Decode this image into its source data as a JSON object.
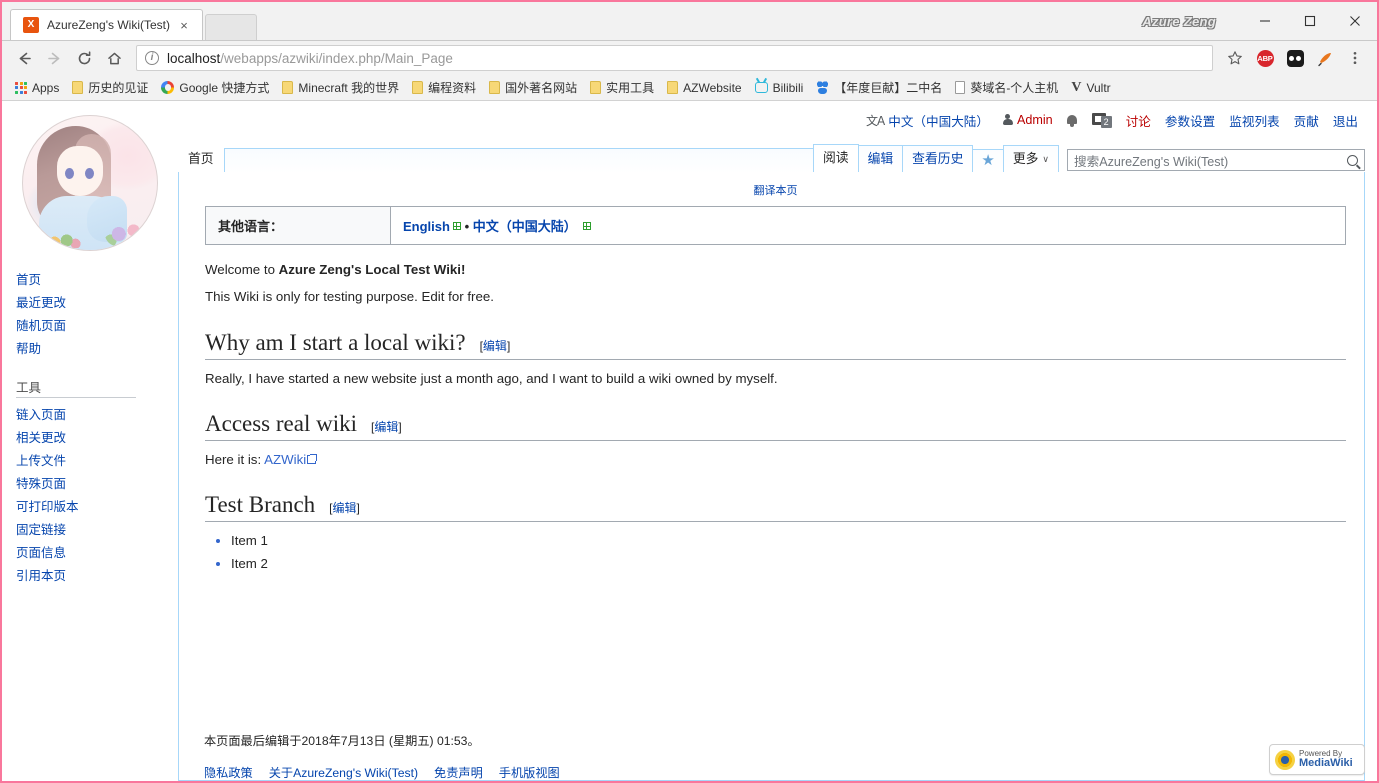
{
  "browser": {
    "tab": {
      "title": "AzureZeng's Wiki(Test)",
      "favicon_letter": "X",
      "close": "×"
    },
    "window_user": "Azure Zeng",
    "controls": {
      "minimize": "minimize-icon",
      "maximize": "maximize-icon",
      "close": "close-icon"
    },
    "nav": {
      "back": "back-icon",
      "forward": "forward-icon",
      "reload": "reload-icon",
      "home": "home-icon"
    },
    "omnibox": {
      "info": "i",
      "host": "localhost",
      "path": "/webapps/azwiki/index.php/Main_Page"
    },
    "actions": {
      "bookmark_star": "☆",
      "abp": "ABP",
      "menu": "⋮"
    },
    "bookmarks": [
      {
        "label": "Apps",
        "icon": "apps-grid-icon"
      },
      {
        "label": "历史的见证",
        "icon": "folder-icon"
      },
      {
        "label": "Google 快捷方式",
        "icon": "google-icon"
      },
      {
        "label": "Minecraft 我的世界",
        "icon": "folder-icon"
      },
      {
        "label": "编程资料",
        "icon": "folder-icon"
      },
      {
        "label": "国外著名网站",
        "icon": "folder-icon"
      },
      {
        "label": "实用工具",
        "icon": "folder-icon"
      },
      {
        "label": "AZWebsite",
        "icon": "folder-icon"
      },
      {
        "label": "Bilibili",
        "icon": "bilibili-icon"
      },
      {
        "label": "【年度巨献】二中名",
        "icon": "baidu-icon"
      },
      {
        "label": "葵域名-个人主机",
        "icon": "page-icon"
      },
      {
        "label": "Vultr",
        "icon": "vultr-icon"
      }
    ]
  },
  "wiki": {
    "personal": {
      "language": "中文（中国大陆）",
      "language_icon": "文A",
      "user": "Admin",
      "bell_icon": "bell-icon",
      "tray_icon": "tray-icon",
      "tray_badge": "2",
      "links": [
        "讨论",
        "参数设置",
        "监视列表",
        "贡献",
        "退出"
      ]
    },
    "sidebar": {
      "nav_items": [
        "首页",
        "最近更改",
        "随机页面",
        "帮助"
      ],
      "tools_heading": "工具",
      "tools_items": [
        "链入页面",
        "相关更改",
        "上传文件",
        "特殊页面",
        "可打印版本",
        "固定链接",
        "页面信息",
        "引用本页"
      ]
    },
    "namespace_tabs": [
      {
        "label": "首页",
        "selected": true
      }
    ],
    "action_tabs": [
      {
        "label": "阅读",
        "selected": true
      },
      {
        "label": "编辑",
        "selected": false
      },
      {
        "label": "查看历史",
        "selected": false
      }
    ],
    "star_tab": "★",
    "more_tab": {
      "label": "更多",
      "caret": "∨"
    },
    "search": {
      "placeholder": "搜索AzureZeng's Wiki(Test)",
      "value": "",
      "icon": "search-icon"
    },
    "translate_link": "翻译本页",
    "langbar": {
      "header": "其他语言：",
      "languages": [
        "English",
        "中文（中国大陆）"
      ],
      "separator": "•"
    },
    "content": {
      "intro_prefix": "Welcome to ",
      "intro_bold": "Azure Zeng's Local Test Wiki!",
      "intro_line2": "This Wiki is only for testing purpose. Edit for free.",
      "edit_label": "[编辑]",
      "edit_bracket_open": "[",
      "edit_bracket_close": "]",
      "edit_word": "编辑",
      "sections": [
        {
          "title": "Why am I start a local wiki?",
          "paragraph": "Really, I have started a new website just a month ago, and I want to build a wiki owned by myself."
        },
        {
          "title": "Access real wiki",
          "paragraph_prefix": "Here it is: ",
          "link_text": "AZWiki"
        },
        {
          "title": "Test Branch",
          "items": [
            "Item 1",
            "Item 2"
          ]
        }
      ]
    },
    "footer": {
      "lastmod": "本页面最后编辑于2018年7月13日 (星期五) 01:53。",
      "links": [
        "隐私政策",
        "关于AzureZeng's Wiki(Test)",
        "免责声明",
        "手机版视图"
      ],
      "powered_by_small": "Powered By",
      "powered_by_name": "MediaWiki"
    }
  },
  "colors": {
    "window_border": "#f9779c",
    "link": "#0645ad",
    "wiki_border": "#a7d7f9",
    "red_link": "#ba0000",
    "favicon": "#e8540e"
  }
}
